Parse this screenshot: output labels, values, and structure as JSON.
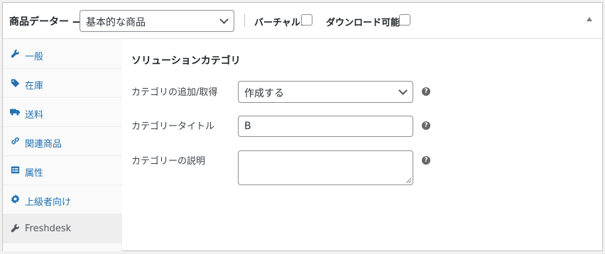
{
  "header": {
    "title": "商品データー —",
    "product_type": "基本的な商品",
    "virtual_label": "バーチャル:",
    "downloadable_label": "ダウンロード可能:"
  },
  "tabs": [
    {
      "label": "一般",
      "icon": "wrench-icon",
      "active": false
    },
    {
      "label": "在庫",
      "icon": "tag-icon",
      "active": false
    },
    {
      "label": "送料",
      "icon": "truck-icon",
      "active": false
    },
    {
      "label": "関連商品",
      "icon": "link-icon",
      "active": false
    },
    {
      "label": "属性",
      "icon": "list-icon",
      "active": false
    },
    {
      "label": "上級者向け",
      "icon": "gear-icon",
      "active": false
    },
    {
      "label": "Freshdesk",
      "icon": "wrench-icon",
      "active": true
    }
  ],
  "section": {
    "title": "ソリューションカテゴリ",
    "fields": {
      "category_add": {
        "label": "カテゴリの追加/取得",
        "value": "作成する"
      },
      "category_title": {
        "label": "カテゴリータイトル",
        "value": "B"
      },
      "category_desc": {
        "label": "カテゴリーの説明",
        "value": ""
      }
    },
    "help_glyph": "?"
  }
}
